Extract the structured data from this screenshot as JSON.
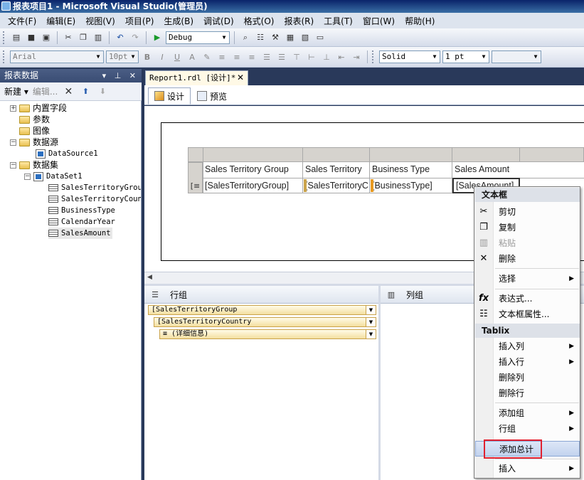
{
  "window": {
    "title": "报表项目1 - Microsoft Visual Studio(管理员)"
  },
  "menu": [
    "文件(F)",
    "编辑(E)",
    "视图(V)",
    "项目(P)",
    "生成(B)",
    "调试(D)",
    "格式(O)",
    "报表(R)",
    "工具(T)",
    "窗口(W)",
    "帮助(H)"
  ],
  "toolbar1": {
    "config": "Debug"
  },
  "toolbar2": {
    "font": "Arial",
    "size": "10pt",
    "border_style": "Solid",
    "border_width": "1 pt"
  },
  "panel": {
    "title": "报表数据",
    "new_label": "新建",
    "edit_label": "编辑...",
    "tree": {
      "builtin": "内置字段",
      "params": "参数",
      "images": "图像",
      "datasources": "数据源",
      "datasource1": "DataSource1",
      "datasets": "数据集",
      "dataset1": "DataSet1",
      "fields": [
        "SalesTerritoryGroup",
        "SalesTerritoryCountry",
        "BusinessType",
        "CalendarYear",
        "SalesAmount"
      ]
    }
  },
  "doc": {
    "tab": "Report1.rdl [设计]*",
    "design_tab": "设计",
    "preview_tab": "预览",
    "table": {
      "headers": [
        "Sales Territory Group",
        "Sales Territory",
        "Business Type",
        "Sales Amount"
      ],
      "details": [
        "[SalesTerritoryGroup]",
        "[SalesTerritoryC",
        "[BusinessType]",
        "[SalesAmount]"
      ]
    },
    "row_groups_title": "行组",
    "col_groups_title": "列组",
    "row_groups": [
      "[SalesTerritoryGroup",
      "[SalesTerritoryCountry",
      "(详细信息)"
    ]
  },
  "context_menu": {
    "header1": "文本框",
    "cut": "剪切",
    "copy": "复制",
    "paste": "粘贴",
    "delete": "删除",
    "select": "选择",
    "expression": "表达式...",
    "textbox_props": "文本框属性...",
    "header2": "Tablix",
    "insert_col": "插入列",
    "insert_row": "插入行",
    "delete_col": "删除列",
    "delete_row": "删除行",
    "add_group": "添加组",
    "row_group": "行组",
    "add_total": "添加总计",
    "insert": "插入"
  },
  "colors": {
    "highlight_box": "#e02030",
    "panel_header": "#3a4d74",
    "group_fill": "#f4dfa0"
  }
}
